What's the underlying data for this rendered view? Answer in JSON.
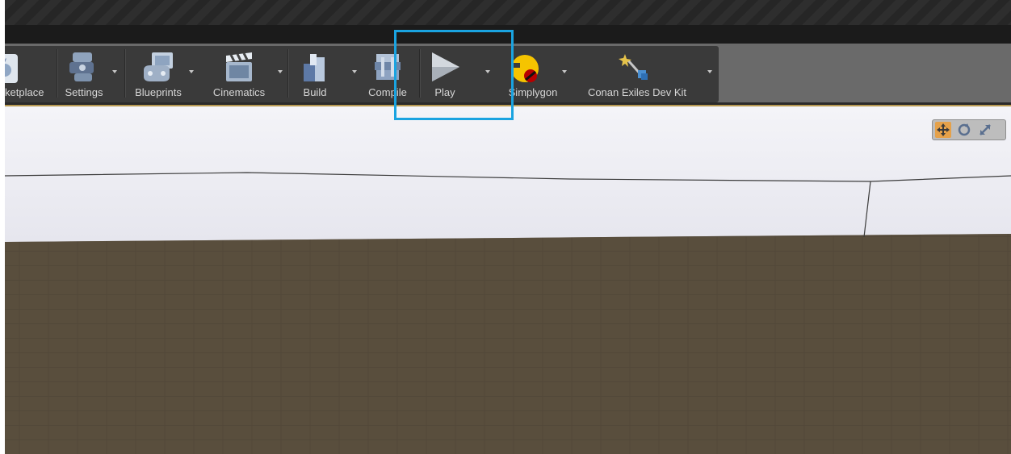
{
  "toolbar": {
    "marketplace_label": "ketplace",
    "settings_label": "Settings",
    "blueprints_label": "Blueprints",
    "cinematics_label": "Cinematics",
    "build_label": "Build",
    "compile_label": "Compile",
    "play_label": "Play",
    "simplygon_label": "Simplygon",
    "devkit_label": "Conan Exiles Dev Kit"
  },
  "icons": {
    "marketplace": "marketplace-icon",
    "settings": "settings-icon",
    "blueprints": "blueprints-icon",
    "cinematics": "cinematics-icon",
    "build": "build-icon",
    "compile": "compile-icon",
    "play": "play-icon",
    "simplygon": "simplygon-icon",
    "devkit": "devkit-icon",
    "translate": "translate-icon",
    "rotate": "rotate-icon",
    "scale": "scale-icon"
  },
  "colors": {
    "highlight": "#1aa3e0",
    "accent": "#b89a52",
    "simplygon": "#f5c400"
  }
}
